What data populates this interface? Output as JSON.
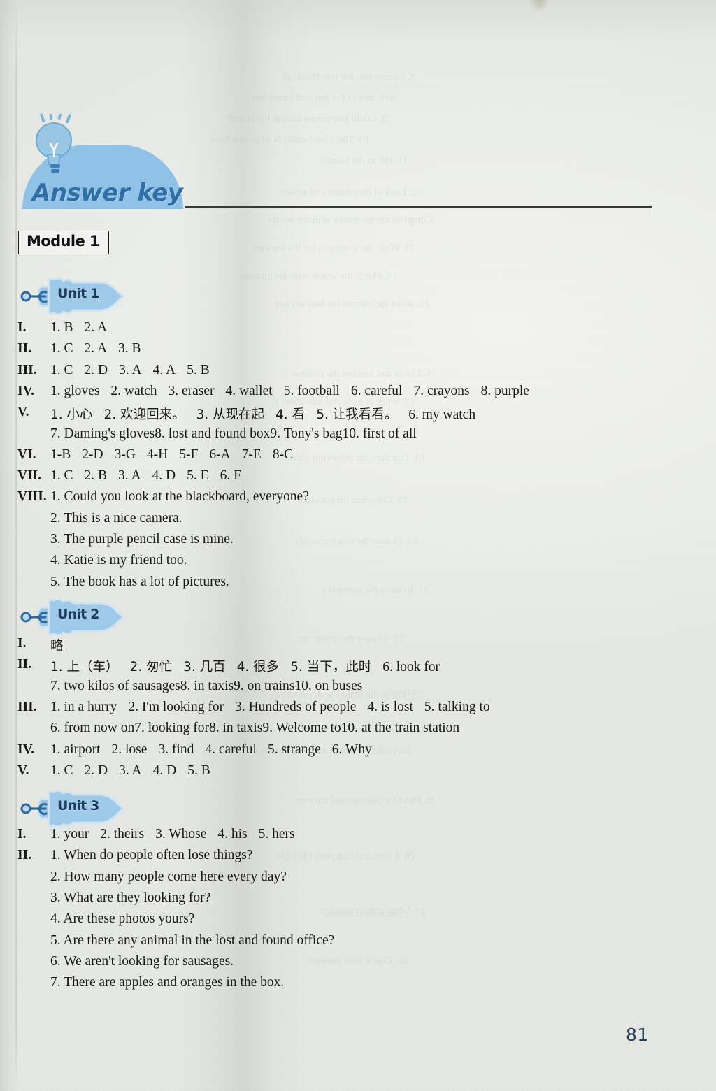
{
  "page": {
    "title": "Answer key",
    "page_number": "81",
    "accent_blue": "#8fc2e6",
    "title_color": "#2f6fa8",
    "badge_text_color": "#1d3c5c",
    "page_number_color": "#27405c",
    "paper_color": "#eceeea"
  },
  "icons": {
    "lightbulb": "lightbulb-icon",
    "tag": "tag-badge-icon"
  },
  "module": {
    "label": "Module 1"
  },
  "units": [
    {
      "badge": "Unit 1",
      "rows": [
        {
          "numeral": "I.",
          "items": [
            "1. B",
            "2. A"
          ]
        },
        {
          "numeral": "II.",
          "items": [
            "1. C",
            "2. A",
            "3. B"
          ]
        },
        {
          "numeral": "III.",
          "items": [
            "1. C",
            "2. D",
            "3. A",
            "4. A",
            "5. B"
          ]
        },
        {
          "numeral": "IV.",
          "items": [
            "1. gloves",
            "2. watch",
            "3. eraser",
            "4. wallet",
            "5. football",
            "6. careful",
            "7. crayons",
            "8. purple"
          ]
        },
        {
          "numeral": "V.",
          "items": [
            "1. 小心",
            "2. 欢迎回来。",
            "3. 从现在起",
            "4. 看",
            "5. 让我看看。",
            "6. my watch"
          ]
        },
        {
          "numeral": "",
          "items": [
            "7. Daming's gloves",
            "8. lost and found box",
            "9. Tony's bag",
            "10. first of all"
          ]
        },
        {
          "numeral": "VI.",
          "items": [
            "1-B",
            "2-D",
            "3-G",
            "4-H",
            "5-F",
            "6-A",
            "7-E",
            "8-C"
          ]
        },
        {
          "numeral": "VII.",
          "items": [
            "1. C",
            "2. B",
            "3. A",
            "4. D",
            "5. E",
            "6. F"
          ]
        },
        {
          "numeral": "VIII.",
          "items": [
            "1. Could you look at the blackboard, everyone?"
          ]
        },
        {
          "numeral": "",
          "items": [
            "2. This is a nice camera."
          ]
        },
        {
          "numeral": "",
          "items": [
            "3. The purple pencil case is mine."
          ]
        },
        {
          "numeral": "",
          "items": [
            "4. Katie is my friend too."
          ]
        },
        {
          "numeral": "",
          "items": [
            "5. The book has a lot of pictures."
          ]
        }
      ]
    },
    {
      "badge": "Unit 2",
      "rows": [
        {
          "numeral": "I.",
          "items": [
            "略"
          ]
        },
        {
          "numeral": "II.",
          "items": [
            "1. 上（车）",
            "2. 匆忙",
            "3. 几百",
            "4. 很多",
            "5. 当下，此时",
            "6. look for"
          ]
        },
        {
          "numeral": "",
          "items": [
            "7. two kilos of sausages",
            "8. in taxis",
            "9. on trains",
            "10. on buses"
          ]
        },
        {
          "numeral": "III.",
          "items": [
            "1. in a hurry",
            "2. I'm looking for",
            "3. Hundreds of people",
            "4. is lost",
            "5. talking to"
          ]
        },
        {
          "numeral": "",
          "items": [
            "6. from now on",
            "7. looking for",
            "8. in taxis",
            "9. Welcome to",
            "10. at the train station"
          ]
        },
        {
          "numeral": "IV.",
          "items": [
            "1. airport",
            "2. lose",
            "3. find",
            "4. careful",
            "5. strange",
            "6. Why"
          ]
        },
        {
          "numeral": "V.",
          "items": [
            "1. C",
            "2. D",
            "3. A",
            "4. D",
            "5. B"
          ]
        }
      ]
    },
    {
      "badge": "Unit 3",
      "rows": [
        {
          "numeral": "I.",
          "items": [
            "1. your",
            "2. theirs",
            "3. Whose",
            "4. his",
            "5. hers"
          ]
        },
        {
          "numeral": "II.",
          "items": [
            "1. When do people often lose things?"
          ]
        },
        {
          "numeral": "",
          "items": [
            "2. How many people come here every day?"
          ]
        },
        {
          "numeral": "",
          "items": [
            "3. What are they looking for?"
          ]
        },
        {
          "numeral": "",
          "items": [
            "4. Are these photos yours?"
          ]
        },
        {
          "numeral": "",
          "items": [
            "5. Are there any animal in the lost and found office?"
          ]
        },
        {
          "numeral": "",
          "items": [
            "6. We aren't looking for sausages."
          ]
        },
        {
          "numeral": "",
          "items": [
            "7. There are apples and oranges in the box."
          ]
        }
      ]
    }
  ]
}
